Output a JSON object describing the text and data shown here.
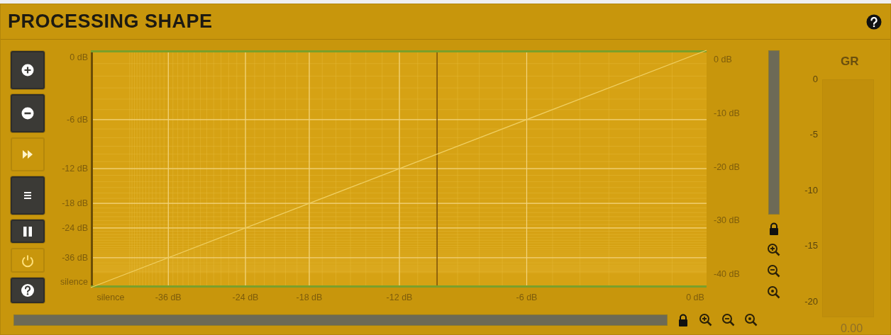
{
  "header": {
    "title": "PROCESSING SHAPE"
  },
  "side_buttons": [
    {
      "kind": "plus"
    },
    {
      "kind": "minus"
    },
    {
      "kind": "forward"
    },
    {
      "kind": "menu"
    },
    {
      "kind": "pause"
    },
    {
      "kind": "power"
    },
    {
      "kind": "help"
    }
  ],
  "graph": {
    "input_axis": [
      "silence",
      "-36 dB",
      "-24 dB",
      "-18 dB",
      "-12 dB",
      "-6 dB",
      "0 dB"
    ],
    "output_axis": [
      "0 dB",
      "-6 dB",
      "-12 dB",
      "-18 dB",
      "-24 dB",
      "-36 dB",
      "silence"
    ],
    "output_scale": [
      "0 dB",
      "-10 dB",
      "-20 dB",
      "-30 dB",
      "-40 dB"
    ]
  },
  "vertical_zoom": {
    "tools": [
      {
        "kind": "lock"
      },
      {
        "kind": "zoom-in"
      },
      {
        "kind": "zoom-out"
      },
      {
        "kind": "zoom-reset"
      }
    ]
  },
  "horizontal_zoom": {
    "tools": [
      {
        "kind": "lock"
      },
      {
        "kind": "zoom-in"
      },
      {
        "kind": "zoom-out"
      },
      {
        "kind": "zoom-reset"
      }
    ]
  },
  "gr_meter": {
    "title": "GR",
    "scale": [
      "0",
      "-5",
      "-10",
      "-15",
      "-20"
    ],
    "reading": "0.00"
  }
}
